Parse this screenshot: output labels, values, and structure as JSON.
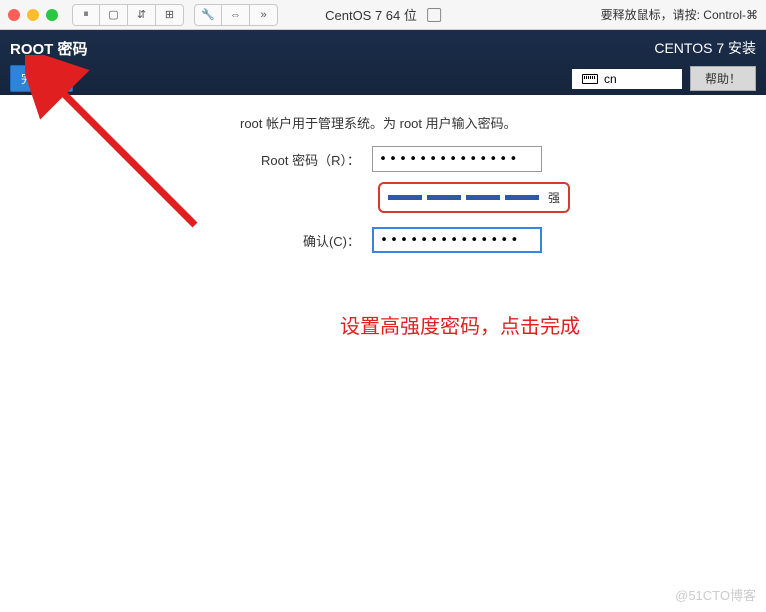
{
  "titlebar": {
    "vm_name": "CentOS 7 64 位",
    "hint": "要释放鼠标，请按: Control-⌘"
  },
  "header": {
    "title": "ROOT 密码",
    "done_btn": "完成(D)",
    "right_title": "CENTOS 7 安装",
    "keyboard": "cn",
    "help_btn": "帮助！"
  },
  "form": {
    "desc": "root 帐户用于管理系统。为 root 用户输入密码。",
    "pw_label": "Root 密码（R）：",
    "pw_value": "••••••••••••••",
    "confirm_label": "确认(C)：",
    "confirm_value": "••••••••••••••",
    "strength_label": "强"
  },
  "annotation": "设置高强度密码，点击完成",
  "watermark": "@51CTO博客"
}
